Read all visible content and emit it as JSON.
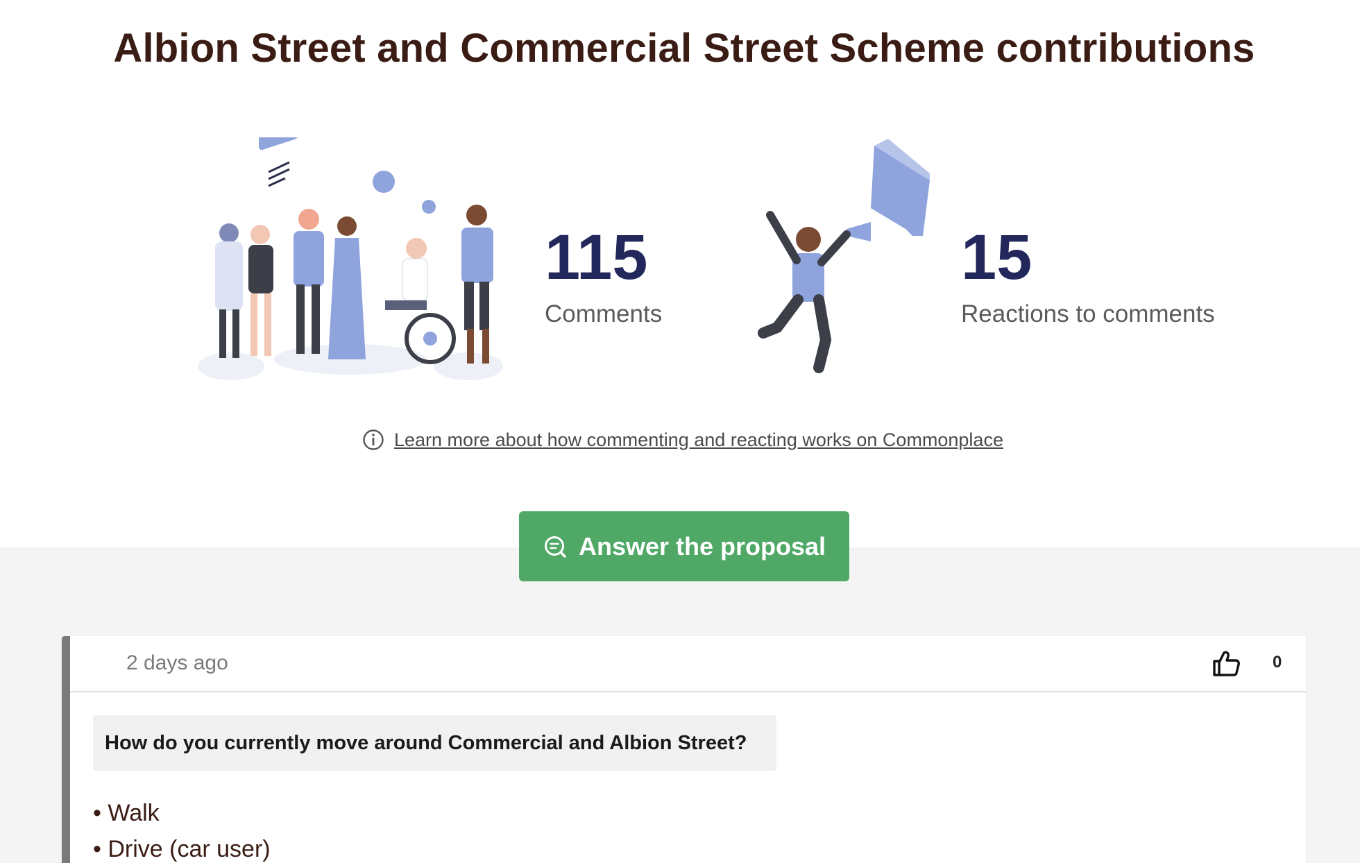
{
  "page": {
    "title": "Albion Street and Commercial Street Scheme contributions"
  },
  "stats": {
    "comments": {
      "number": "115",
      "label": "Comments"
    },
    "reactions": {
      "number": "15",
      "label": "Reactions to comments"
    }
  },
  "learn_more": {
    "icon": "info-icon",
    "text": "Learn more about how commenting and reacting works on Commonplace"
  },
  "cta": {
    "icon": "comment-search-icon",
    "label": "Answer the proposal"
  },
  "comment_card": {
    "date": "2 days ago",
    "like_icon": "thumbs-up-icon",
    "like_count": "0",
    "question": "How do you currently move around Commercial and Albion Street?",
    "answers": [
      "Walk",
      "Drive (car user)"
    ]
  },
  "colors": {
    "title": "#3a1c14",
    "stat_number": "#22285c",
    "cta_background": "#4fa866",
    "illustration_accent": "#8fa3dc",
    "card_border": "#7a7a7a"
  }
}
